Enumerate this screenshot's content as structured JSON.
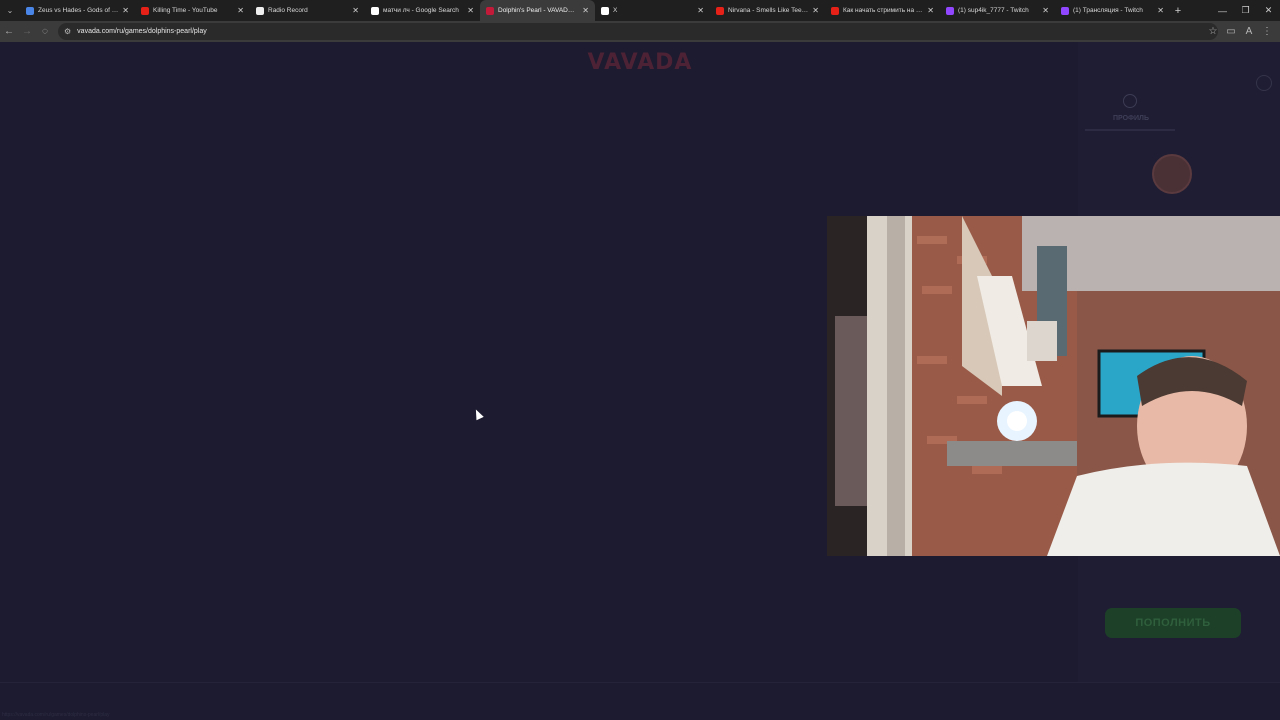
{
  "tabs": [
    {
      "title": "Zeus vs Hades - Gods of War",
      "favicon_color": "#4a86e8"
    },
    {
      "title": "Killing Time - YouTube",
      "favicon_color": "#e62117"
    },
    {
      "title": "Radio Record",
      "favicon_color": "#eeeeee"
    },
    {
      "title": "матчи лч - Google Search",
      "favicon_color": "#ffffff"
    },
    {
      "title": "Dolphin's Pearl - VAVADA Onl",
      "favicon_color": "#c41a3a",
      "active": true
    },
    {
      "title": "X",
      "favicon_color": "#ffffff"
    },
    {
      "title": "Nirvana - Smells Like Teen Sp",
      "favicon_color": "#e62117"
    },
    {
      "title": "Как начать стримить на Twit",
      "favicon_color": "#e62117"
    },
    {
      "title": "(1) sup4ik_7777 - Twitch",
      "favicon_color": "#9146ff"
    },
    {
      "title": "(1) Трансляция - Twitch",
      "favicon_color": "#9146ff"
    }
  ],
  "address": {
    "url": "vavada.com/ru/games/dolphins-pearl/play"
  },
  "page": {
    "logo": "VAVADA",
    "profile_label": "ПРОФИЛЬ",
    "deposit_label": "ПОПОЛНИТЬ",
    "status_url": "https://vavada.com/ru/games/dolphins-pearl/play"
  },
  "colors": {
    "page_bg": "#1c1b2f",
    "logo": "#4d2235",
    "deposit_bg": "#1d4028"
  }
}
